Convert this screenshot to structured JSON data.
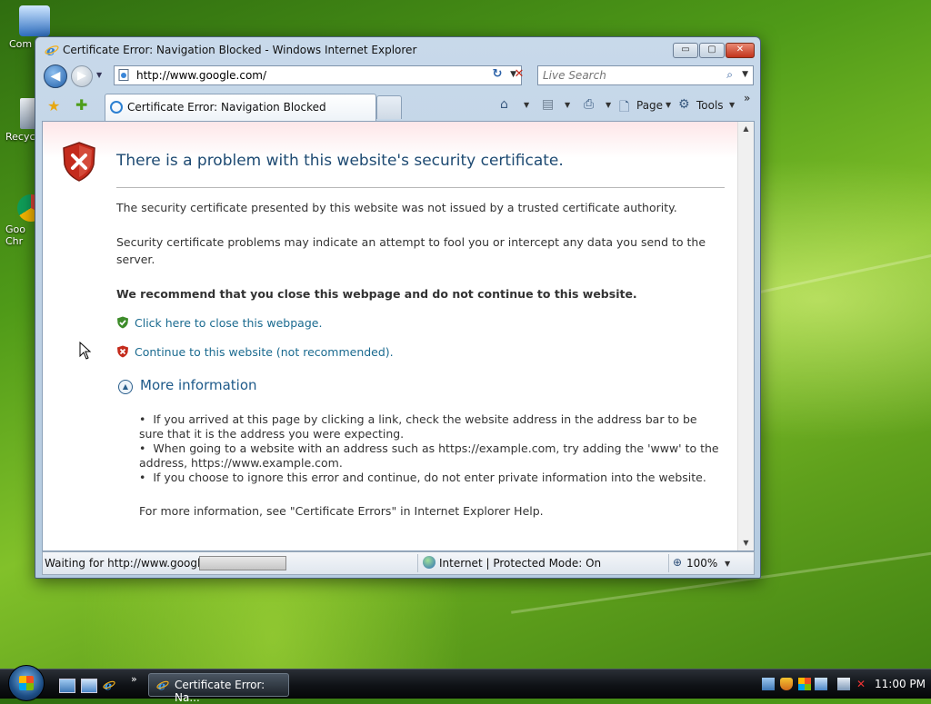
{
  "desktop": {
    "icons": [
      {
        "label": "Com"
      },
      {
        "label": "Recyc"
      },
      {
        "label": "Goo\nChr"
      }
    ]
  },
  "window": {
    "title": "Certificate Error: Navigation Blocked - Windows Internet Explorer",
    "minimize_label": "▭",
    "maximize_label": "▢",
    "close_label": "✕"
  },
  "nav": {
    "back_label": "◀",
    "forward_label": "▶",
    "address": "http://www.google.com/",
    "refresh_label": "↻",
    "stop_label": "✕",
    "search_placeholder": "Live Search",
    "search_icon": "search-icon"
  },
  "tabs": {
    "active_label": "Certificate Error: Navigation Blocked",
    "commands": {
      "page_label": "Page",
      "tools_label": "Tools",
      "overflow_label": "»"
    }
  },
  "page": {
    "title": "There is a problem with this website's security certificate.",
    "para1": "The security certificate presented by this website was not issued by a trusted certificate authority.",
    "para2": "Security certificate problems may indicate an attempt to fool you or intercept any data you send to the server.",
    "recommend": "We recommend that you close this webpage and do not continue to this website.",
    "close_link": "Click here to close this webpage.",
    "continue_link": "Continue to this website (not recommended).",
    "more_info": "More information",
    "bullets": [
      "If you arrived at this page by clicking a link, check the website address in the address bar to be sure that it is the address you were expecting.",
      "When going to a website with an address such as https://example.com, try adding the 'www' to the address, https://www.example.com.",
      "If you choose to ignore this error and continue, do not enter private information into the website."
    ],
    "more_para": "For more information, see \"Certificate Errors\" in Internet Explorer Help."
  },
  "status": {
    "text": "Waiting for http://www.google.",
    "zone": "Internet | Protected Mode: On",
    "zoom": "100%"
  },
  "taskbar": {
    "task_label": "Certificate Error: Na...",
    "clock": "11:00 PM",
    "quick_launch_more": "»"
  },
  "colors": {
    "title_blue": "#1e4a72",
    "link_teal": "#1a6a8f",
    "shield_red": "#c42b1c",
    "shield_green": "#3d8c2a"
  }
}
